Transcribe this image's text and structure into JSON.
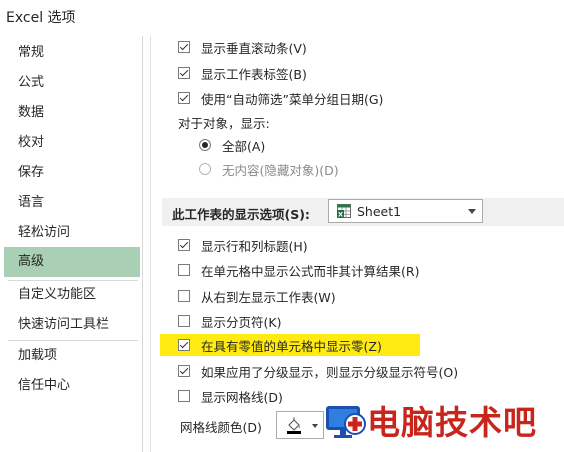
{
  "window": {
    "title": "Excel 选项"
  },
  "sidebar": {
    "items": [
      {
        "label": "常规"
      },
      {
        "label": "公式"
      },
      {
        "label": "数据"
      },
      {
        "label": "校对"
      },
      {
        "label": "保存"
      },
      {
        "label": "语言"
      },
      {
        "label": "轻松访问"
      },
      {
        "label": "高级",
        "selected": true
      },
      {
        "label": "自定义功能区"
      },
      {
        "label": "快速访问工具栏"
      },
      {
        "label": "加载项"
      },
      {
        "label": "信任中心"
      }
    ]
  },
  "options": {
    "show_vertical_scroll": {
      "label": "显示垂直滚动条(V)",
      "checked": true
    },
    "show_sheet_tabs": {
      "label": "显示工作表标签(B)",
      "checked": true
    },
    "group_dates_autofilter": {
      "label": "使用“自动筛选”菜单分组日期(G)",
      "checked": true
    },
    "objects_show_label": "对于对象，显示:",
    "radio_all": {
      "label": "全部(A)",
      "checked": true
    },
    "radio_nothing": {
      "label": "无内容(隐藏对象)(D)",
      "checked": false,
      "disabled": true
    }
  },
  "sheet_section": {
    "label": "此工作表的显示选项(S):",
    "selected_sheet": "Sheet1",
    "options": {
      "show_row_col_headers": {
        "label": "显示行和列标题(H)",
        "checked": true
      },
      "show_formulas": {
        "label": "在单元格中显示公式而非其计算结果(R)",
        "checked": false
      },
      "right_to_left": {
        "label": "从右到左显示工作表(W)",
        "checked": false
      },
      "show_page_breaks": {
        "label": "显示分页符(K)",
        "checked": false
      },
      "show_zero": {
        "label": "在具有零值的单元格中显示零(Z)",
        "checked": true,
        "highlight_color": "#ffeb10"
      },
      "show_outline_symbols": {
        "label": "如果应用了分级显示，则显示分级显示符号(O)",
        "checked": true
      },
      "show_gridlines": {
        "label": "显示网格线(D)",
        "checked": false
      }
    },
    "gridline_color_label": "网格线颜色(D)"
  },
  "watermark": {
    "text": "电脑技术吧",
    "color": "#c8261d"
  },
  "colors": {
    "selected_nav": "#a9cfb4",
    "section_bar": "#f0f0f0"
  }
}
